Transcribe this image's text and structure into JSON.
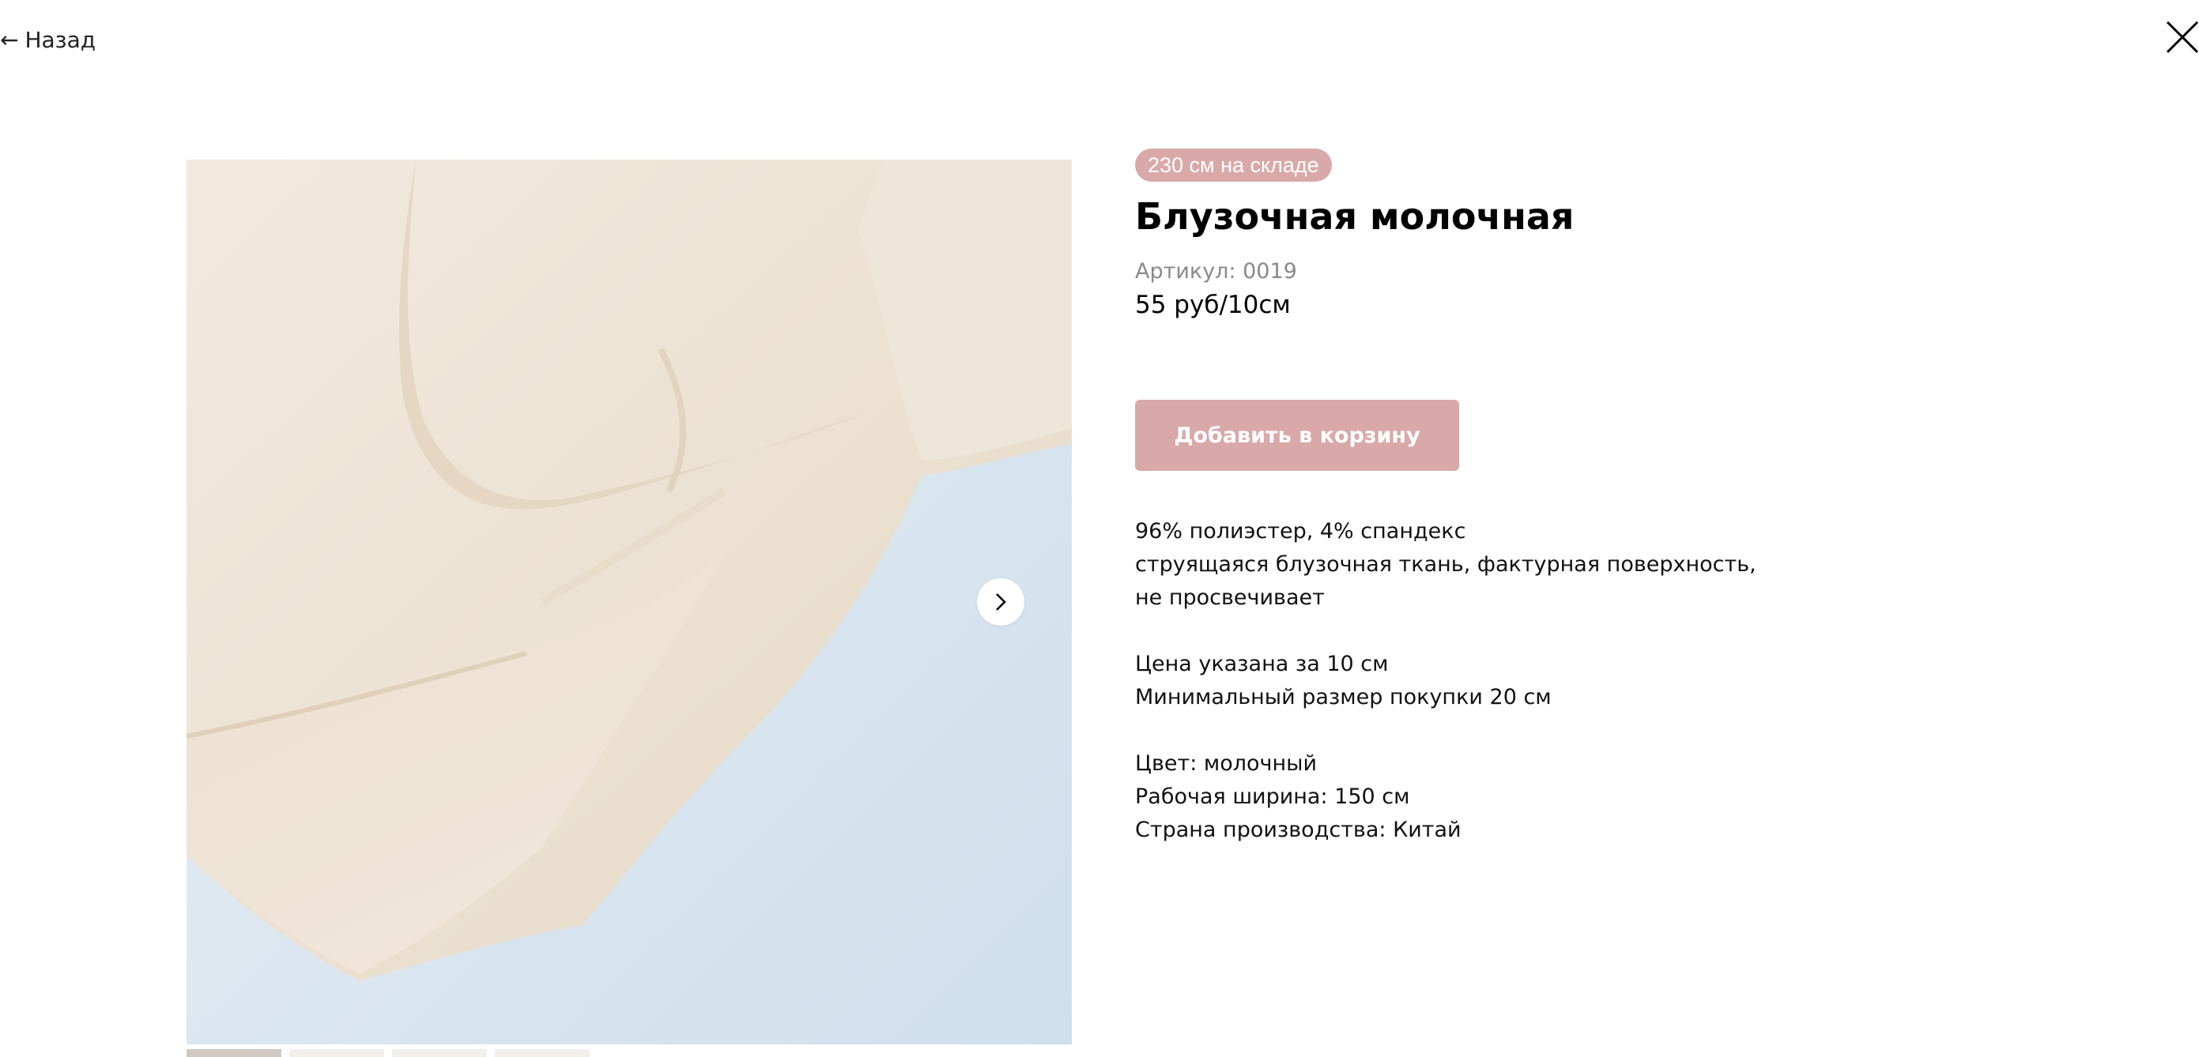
{
  "nav": {
    "back_arrow": "←",
    "back_label": "Назад"
  },
  "product": {
    "stock_badge": "230 см на складе",
    "title": "Блузочная молочная",
    "sku": "Артикул: 0019",
    "price": "55 руб/10см",
    "add_to_cart_label": "Добавить в корзину",
    "description": {
      "composition": "96% полиэстер, 4% спандекс",
      "feature_line1": "струящаяся блузочная ткань, фактурная поверхность,",
      "feature_line2": "не просвечивает",
      "price_note": "Цена указана за 10 см",
      "min_purchase": "Минимальный размер покупки 20 см",
      "color": "Цвет: молочный",
      "width": "Рабочая ширина: 150 см",
      "country": "Страна производства: Китай"
    }
  },
  "gallery": {
    "image_subject": "cream fabric draped on light blue background",
    "thumbnail_count": 4,
    "active_thumbnail": 1
  },
  "colors": {
    "accent": "#d9a9aa",
    "fabric": "#ede3d5",
    "background_blue": "#d6e4f0",
    "muted_text": "#8a8a8a"
  },
  "icons": {
    "close": "close-icon",
    "next": "chevron-right-icon",
    "back": "arrow-left-icon"
  }
}
